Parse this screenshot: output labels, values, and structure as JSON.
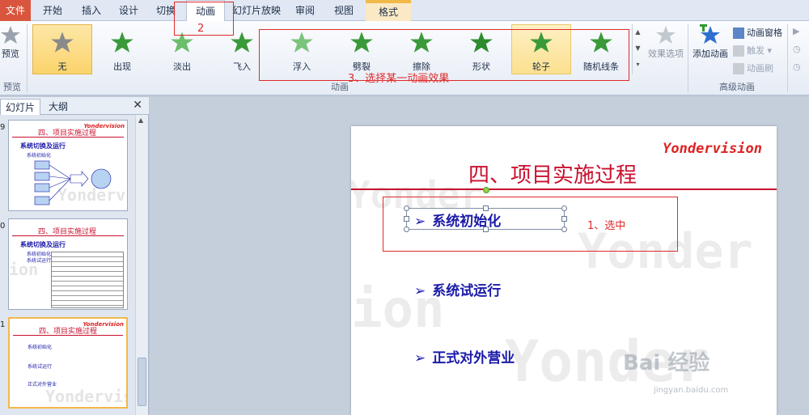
{
  "tabs": {
    "file": "文件",
    "items": [
      "开始",
      "插入",
      "设计",
      "切换",
      "动画",
      "幻灯片放映",
      "审阅",
      "视图",
      "格式"
    ],
    "active": "动画"
  },
  "ribbon": {
    "preview": {
      "label": "预览",
      "group": "预览"
    },
    "animations": [
      {
        "label": "无",
        "state": "selected",
        "color": "#8a8a8a"
      },
      {
        "label": "出现",
        "color": "#3a9a3a"
      },
      {
        "label": "淡出",
        "color": "#3a9a3a"
      },
      {
        "label": "飞入",
        "color": "#3a9a3a"
      },
      {
        "label": "浮入",
        "color": "#3a9a3a"
      },
      {
        "label": "劈裂",
        "color": "#3a9a3a"
      },
      {
        "label": "擦除",
        "color": "#3a9a3a"
      },
      {
        "label": "形状",
        "color": "#3a9a3a"
      },
      {
        "label": "轮子",
        "state": "hover",
        "color": "#3a9a3a"
      },
      {
        "label": "随机线条",
        "color": "#3a9a3a"
      }
    ],
    "effect_options": "效果选项",
    "group_animation": "动画",
    "add_animation": "添加动画",
    "animation_pane": "动画窗格",
    "trigger": "触发",
    "painter": "动画刷",
    "group_advanced": "高级动画"
  },
  "annotations": {
    "step1": "1、选中",
    "step2": "2",
    "step3": "3、选择某一动画效果",
    "color": "#e02a2a"
  },
  "pane": {
    "tab_slides": "幻灯片",
    "tab_outline": "大纲",
    "close": "✕",
    "thumbs": [
      {
        "num": "9",
        "title": "四、项目实施过程",
        "logo": "Yondervision",
        "sub": "系统切换及运行",
        "bullets": [
          "系统初始化"
        ],
        "water": "Yonderv"
      },
      {
        "num": "0",
        "title": "四、项目实施过程",
        "logo": "Yondervision",
        "sub": "系统切换及运行",
        "bullets": [
          "系统初始化",
          "系统试运行"
        ],
        "water": "ion"
      },
      {
        "num": "1",
        "title": "四、项目实施过程",
        "logo": "Yondervision",
        "bullets": [
          "系统初始化",
          "系统试运行",
          "正式对外营业"
        ],
        "water": "Yondervis"
      }
    ]
  },
  "slide": {
    "logo": "Yondervision",
    "title": "四、项目实施过程",
    "bullets": [
      "系统初始化",
      "系统试运行",
      "正式对外营业"
    ],
    "watermark1": "Yonder",
    "watermark2": "ion",
    "watermark3": "Yonder"
  },
  "watermark": {
    "baidu": "Bai 经验",
    "url": "jingyan.baidu.com"
  }
}
